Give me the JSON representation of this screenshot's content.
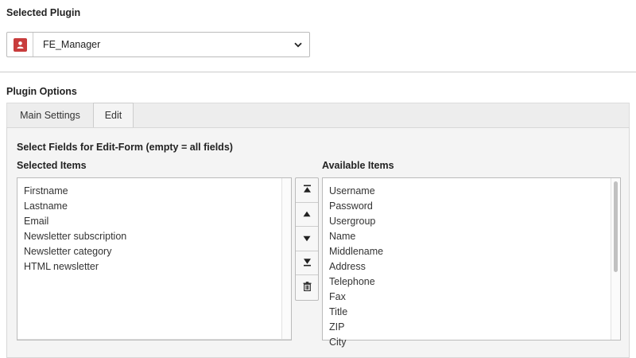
{
  "selected_plugin": {
    "title": "Selected Plugin",
    "value": "FE_Manager",
    "icon": "user-icon",
    "icon_color": "#c83c3c"
  },
  "plugin_options": {
    "title": "Plugin Options",
    "tabs": [
      {
        "label": "Main Settings",
        "active": false
      },
      {
        "label": "Edit",
        "active": true
      }
    ]
  },
  "edit_form": {
    "title": "Select Fields for Edit-Form (empty = all fields)",
    "selected": {
      "label": "Selected Items",
      "items": [
        "Firstname",
        "Lastname",
        "Email",
        "Newsletter subscription",
        "Newsletter category",
        "HTML newsletter"
      ]
    },
    "available": {
      "label": "Available Items",
      "items": [
        "Username",
        "Password",
        "Usergroup",
        "Name",
        "Middlename",
        "Address",
        "Telephone",
        "Fax",
        "Title",
        "ZIP",
        "City"
      ]
    },
    "controls": [
      "move-to-top-icon",
      "move-up-icon",
      "move-down-icon",
      "move-to-bottom-icon",
      "trash-icon"
    ]
  }
}
